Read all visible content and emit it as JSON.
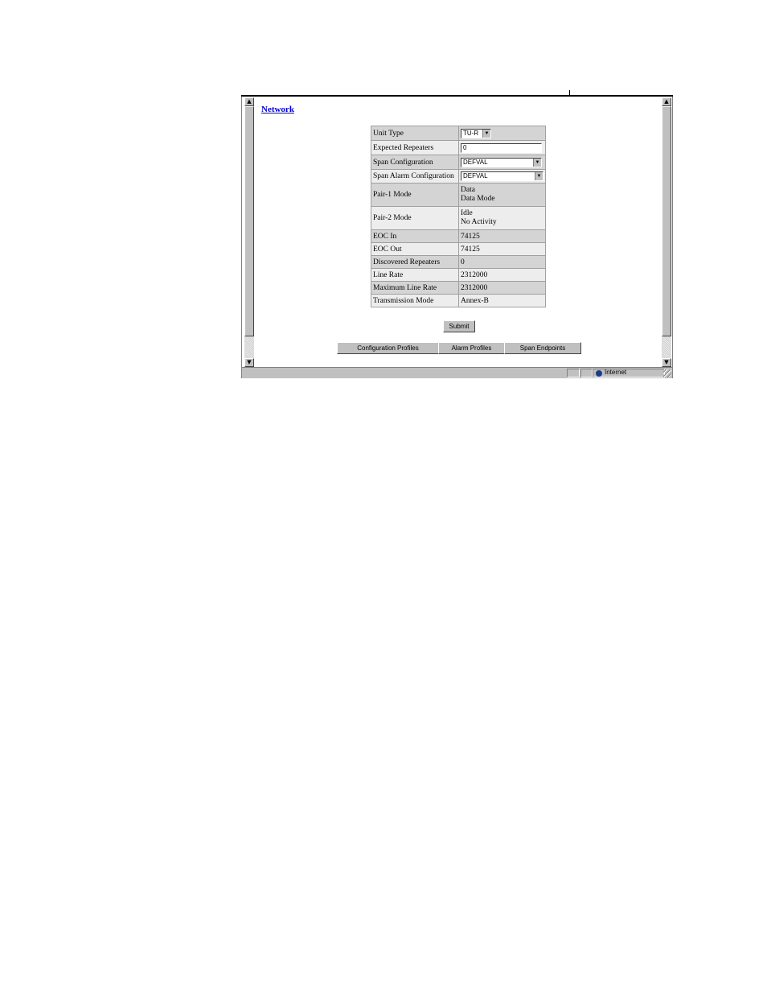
{
  "page": {
    "link": "Network",
    "submit_label": "Submit"
  },
  "form": {
    "rows": [
      {
        "label": "Unit Type",
        "type": "select",
        "value": "TU-R"
      },
      {
        "label": "Expected Repeaters",
        "type": "input",
        "value": "0"
      },
      {
        "label": "Span Configuration",
        "type": "select",
        "value": "DEFVAL"
      },
      {
        "label": "Span Alarm Configuration",
        "type": "select",
        "value": "DEFVAL"
      },
      {
        "label": "Pair-1 Mode",
        "type": "text2",
        "value": "Data",
        "value2": "Data Mode"
      },
      {
        "label": "Pair-2 Mode",
        "type": "text2",
        "value": "Idle",
        "value2": "No Activity"
      },
      {
        "label": "EOC In",
        "type": "text",
        "value": "74125"
      },
      {
        "label": "EOC Out",
        "type": "text",
        "value": "74125"
      },
      {
        "label": "Discovered Repeaters",
        "type": "text",
        "value": "0"
      },
      {
        "label": "Line Rate",
        "type": "text",
        "value": "2312000"
      },
      {
        "label": "Maximum Line Rate",
        "type": "text",
        "value": "2312000"
      },
      {
        "label": "Transmission Mode",
        "type": "text",
        "value": "Annex-B"
      }
    ]
  },
  "nav_buttons": [
    "Configuration Profiles",
    "Alarm Profiles",
    "Span Endpoints"
  ],
  "status": {
    "zone": "Internet",
    "zone_icon": "globe-icon"
  },
  "colors": {
    "link": "#0000cc",
    "row_dark": "#d4d4d4",
    "row_light": "#ededed",
    "chrome": "#c0c0c0"
  }
}
